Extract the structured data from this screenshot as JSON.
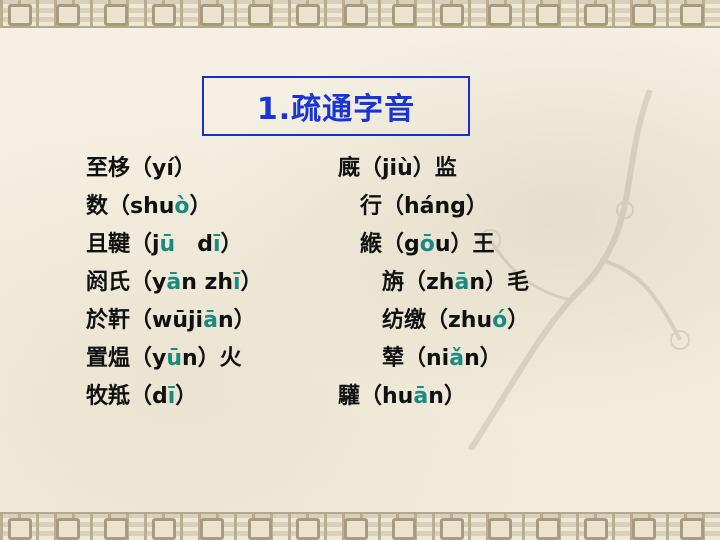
{
  "title": "1.疏通字音",
  "left_column": [
    [
      {
        "t": "至栘（yí）"
      }
    ],
    [
      {
        "t": "数（shu"
      },
      {
        "t": "ò",
        "hl": true
      },
      {
        "t": "）"
      }
    ],
    [
      {
        "t": "且鞬（j"
      },
      {
        "t": "ū",
        "hl": true
      },
      {
        "t": "　d"
      },
      {
        "t": "ī",
        "hl": true
      },
      {
        "t": "）"
      }
    ],
    [
      {
        "t": "阏氏（y"
      },
      {
        "t": "ā",
        "hl": true
      },
      {
        "t": "n zh"
      },
      {
        "t": "ī",
        "hl": true
      },
      {
        "t": "）"
      }
    ],
    [
      {
        "t": "於靬（wūji"
      },
      {
        "t": "ā",
        "hl": true
      },
      {
        "t": "n）"
      }
    ],
    [
      {
        "t": "置煴（y"
      },
      {
        "t": "ū",
        "hl": true
      },
      {
        "t": "n）火"
      }
    ],
    [
      {
        "t": "牧羝（d"
      },
      {
        "t": "ī",
        "hl": true
      },
      {
        "t": "）"
      }
    ]
  ],
  "right_column": [
    [
      {
        "t": "廐（jiù）监"
      }
    ],
    [
      {
        "t": "　行（háng）"
      }
    ],
    [
      {
        "t": "　緱（g"
      },
      {
        "t": "ō",
        "hl": true
      },
      {
        "t": "u）王"
      }
    ],
    [
      {
        "t": "　　旃（zh"
      },
      {
        "t": "ā",
        "hl": true
      },
      {
        "t": "n）毛"
      }
    ],
    [
      {
        "t": "　　纺缴（zhu"
      },
      {
        "t": "ó",
        "hl": true
      },
      {
        "t": "）"
      }
    ],
    [
      {
        "t": "　　辇（ni"
      },
      {
        "t": "ǎ",
        "hl": true
      },
      {
        "t": "n）"
      }
    ],
    [
      {
        "t": "驩（hu"
      },
      {
        "t": "ā",
        "hl": true
      },
      {
        "t": "n）"
      }
    ]
  ],
  "colors": {
    "title": "#1a35d6",
    "title_border": "#1a2fc9",
    "pinyin_highlight": "#1a8a80",
    "body_text": "#111111"
  }
}
